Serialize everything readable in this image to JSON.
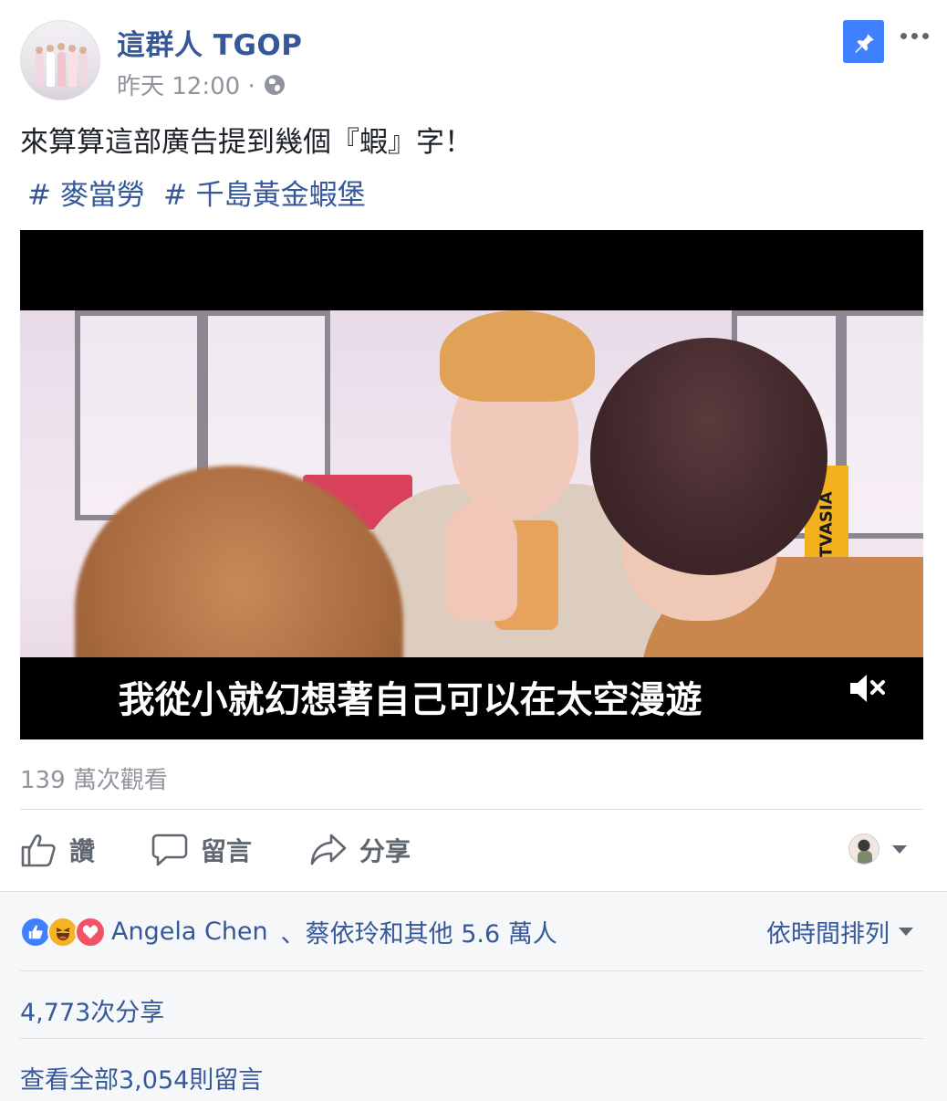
{
  "post": {
    "page_name": "這群人 TGOP",
    "timestamp": "昨天 12:00 ·",
    "text": "來算算這部廣告提到幾個『蝦』字！",
    "hashtags": [
      "# 麥當勞",
      "# 千島黃金蝦堡"
    ]
  },
  "header_icons": {
    "pin": "pin-icon",
    "more": "more-icon",
    "privacy": "globe-icon"
  },
  "video": {
    "subtitle": "我從小就幻想著自己可以在太空漫遊",
    "watermark": "TVASIA",
    "mute_icon": "mute-icon",
    "views": "139 萬次觀看"
  },
  "actions": {
    "like": "讚",
    "comment": "留言",
    "share": "分享"
  },
  "footer": {
    "reaction_names": "Angela Chen",
    "reaction_rest": "、蔡依玲和其他 5.6 萬人",
    "sort_label": "依時間排列",
    "shares": "4,773次分享",
    "view_comments": "查看全部3,054則留言"
  },
  "colors": {
    "link": "#365899",
    "muted": "#90949c",
    "pin_bg": "#4080ff",
    "like": "#4080ff",
    "haha": "#f7b125",
    "love": "#f25268",
    "footer_bg": "#f6f7f9"
  }
}
